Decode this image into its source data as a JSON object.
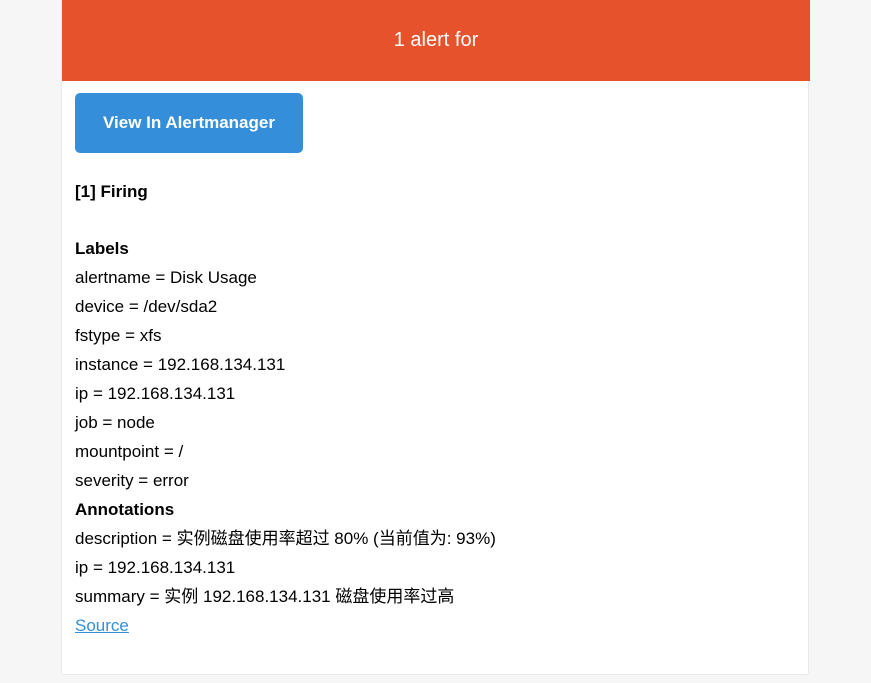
{
  "header": {
    "title": "1 alert for"
  },
  "actions": {
    "view_button_label": "View In Alertmanager"
  },
  "alert": {
    "status_heading": "[1] Firing",
    "labels_heading": "Labels",
    "labels": [
      "alertname = Disk Usage",
      "device = /dev/sda2",
      "fstype = xfs",
      "instance = 192.168.134.131",
      "ip = 192.168.134.131",
      "job = node",
      "mountpoint = /",
      "severity = error"
    ],
    "annotations_heading": "Annotations",
    "annotations": [
      "description = 实例磁盘使用率超过 80% (当前值为: 93%)",
      "ip = 192.168.134.131",
      "summary = 实例 192.168.134.131 磁盘使用率过高"
    ],
    "source_link": "Source"
  },
  "colors": {
    "header_bg": "#e6522c",
    "button_bg": "#348eda",
    "link": "#348eda",
    "page_bg": "#f6f6f6"
  }
}
